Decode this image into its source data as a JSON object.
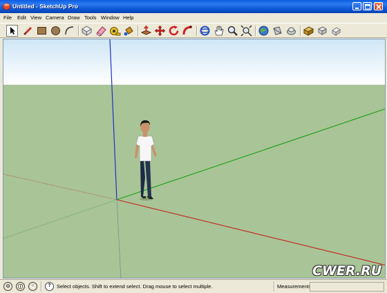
{
  "window": {
    "title": "Untitled - SketchUp Pro",
    "app_icon": "sketchup-logo-icon",
    "controls": [
      "minimize-icon",
      "maximize-icon",
      "close-icon"
    ]
  },
  "menu": {
    "file": "File",
    "edit": "Edit",
    "view": "View",
    "camera": "Camera",
    "draw": "Draw",
    "tools": "Tools",
    "window": "Window",
    "help": "Help"
  },
  "toolbar": {
    "tools": [
      "select-arrow-icon",
      "line-pencil-icon",
      "rectangle-icon",
      "circle-icon",
      "arc-icon",
      "make-component-icon",
      "eraser-icon",
      "tape-measure-icon",
      "paint-bucket-icon",
      "push-pull-icon",
      "move-icon",
      "rotate-icon",
      "follow-me-icon",
      "orbit-icon",
      "pan-hand-icon",
      "zoom-icon",
      "zoom-extents-icon",
      "get-models-icon",
      "share-model-icon",
      "share-component-icon",
      "get-photo-texture-icon",
      "3d-warehouse-icon",
      "extension-icon"
    ],
    "active_tool": "select-arrow-icon"
  },
  "viewport": {
    "sky_color": "#ffffff",
    "sky_top_color": "#cfe6f5",
    "ground_color": "#a9c496",
    "axis_colors": {
      "red": "#c81e1e",
      "green": "#1aa01a",
      "blue": "#1e2fc8"
    },
    "scale_figure": "person-figure-icon"
  },
  "status": {
    "icons": [
      "geo-location-icon",
      "credits-icon",
      "user-icon",
      "help-icon"
    ],
    "text": "Select objects. Shift to extend select. Drag mouse to select multiple.",
    "measurements_label": "Measurements",
    "measurements_value": ""
  },
  "watermark": "CWER.RU"
}
